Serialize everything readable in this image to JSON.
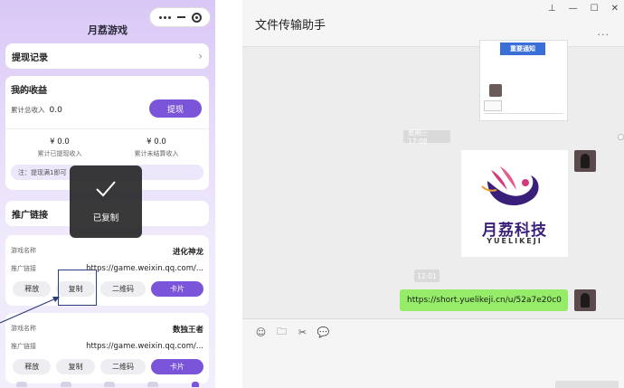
{
  "mini_program": {
    "title": "月荔游戏",
    "withdraw_records": "提现记录",
    "earnings": {
      "title": "我的收益",
      "total_label": "累计总收入",
      "total_value": "0.0",
      "withdraw_button": "提现",
      "withdrawn_value": "¥ 0.0",
      "withdrawn_label": "累计已提现收入",
      "unsettled_value": "¥ 0.0",
      "unsettled_label": "累计未结算收入",
      "notice": "注：提现满1即可"
    },
    "promo_title": "推广链接",
    "games": [
      {
        "name_label": "游戏名称",
        "name": "进化神龙",
        "link_label": "推广链接",
        "link": "https://game.weixin.qq.com/...",
        "buttons": {
          "release": "释放",
          "copy": "复制",
          "qrcode": "二维码",
          "card": "卡片"
        }
      },
      {
        "name_label": "游戏名称",
        "name": "数独王者",
        "link_label": "推广链接",
        "link": "https://game.weixin.qq.com/...",
        "buttons": {
          "release": "释放",
          "copy": "复制",
          "qrcode": "二维码",
          "card": "卡片"
        }
      }
    ],
    "toast": "已复制"
  },
  "wechat": {
    "title": "文件传输助手",
    "window_controls": [
      "⊥",
      "—",
      "☐",
      "✕"
    ],
    "thumbnail_banner": "重要通知",
    "timestamps": [
      "星期三 17:08",
      "12:01"
    ],
    "logo": {
      "cn": "月荔科技",
      "en": "YUELIKEJI"
    },
    "message": "https://short.yuelikeji.cn/u/52a7e20c0",
    "toolbar_icons": [
      "emoji-icon",
      "folder-icon",
      "scissors-icon",
      "chat-bubble-icon"
    ]
  },
  "colors": {
    "accent": "#7a55d9",
    "bubble": "#95ec69",
    "brand": "#3a1f7a"
  }
}
